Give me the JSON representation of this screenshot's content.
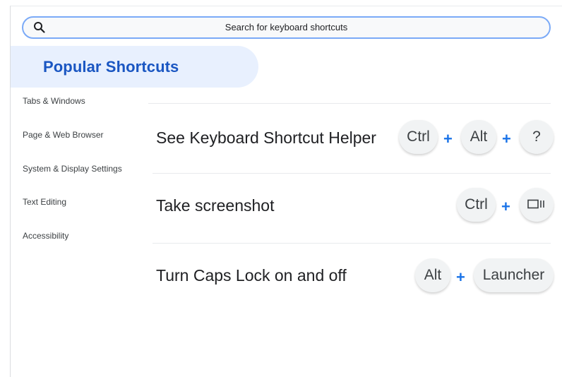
{
  "search": {
    "placeholder": "Search for keyboard shortcuts",
    "icon": "search-icon"
  },
  "sidebar": {
    "popular_label": "Popular Shortcuts",
    "items": [
      {
        "label": "Tabs & Windows"
      },
      {
        "label": "Page & Web Browser"
      },
      {
        "label": "System & Display Settings"
      },
      {
        "label": "Text Editing"
      },
      {
        "label": "Accessibility"
      }
    ]
  },
  "shortcuts": [
    {
      "title": "See Keyboard Shortcut Helper",
      "keys": [
        "Ctrl",
        "Alt",
        "?"
      ]
    },
    {
      "title": "Take screenshot",
      "keys": [
        "Ctrl",
        "show-windows-icon"
      ]
    },
    {
      "title": "Turn Caps Lock on and off",
      "keys": [
        "Alt",
        "Launcher"
      ]
    }
  ],
  "plus_symbol": "+",
  "colors": {
    "accent": "#1a73e8",
    "popular_bg": "#e8f0fe",
    "popular_text": "#1a56c2",
    "search_border": "#7baaf7"
  }
}
